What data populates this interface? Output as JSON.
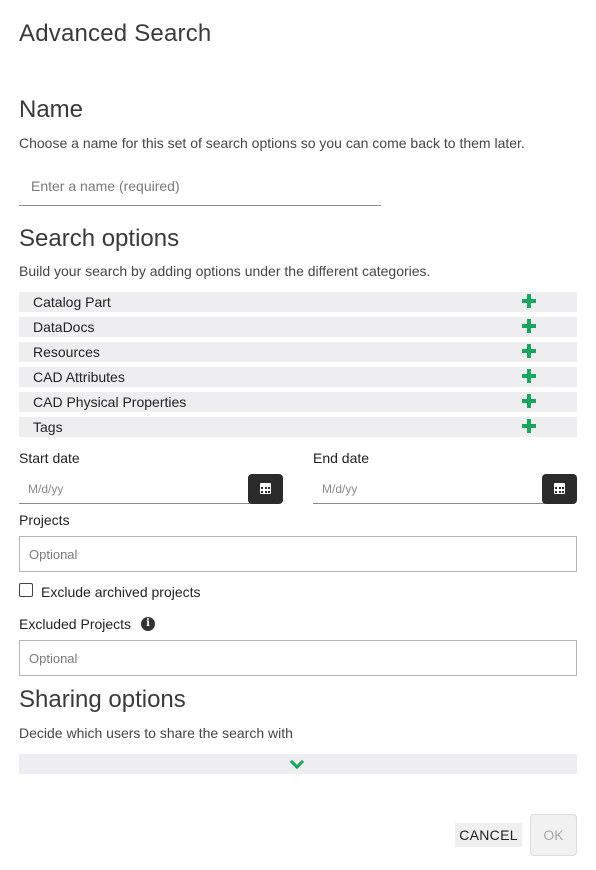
{
  "dialog": {
    "title": "Advanced Search"
  },
  "name_section": {
    "heading": "Name",
    "description": "Choose a name for this set of search options so you can come back to them later.",
    "input_placeholder": "Enter a name (required)",
    "input_value": ""
  },
  "search_section": {
    "heading": "Search options",
    "description": "Build your search by adding options under the different categories.",
    "categories": [
      {
        "label": "Catalog Part",
        "icon": "plus-icon"
      },
      {
        "label": "DataDocs",
        "icon": "plus-icon"
      },
      {
        "label": "Resources",
        "icon": "plus-icon"
      },
      {
        "label": "CAD Attributes",
        "icon": "plus-icon"
      },
      {
        "label": "CAD Physical Properties",
        "icon": "plus-icon"
      },
      {
        "label": "Tags",
        "icon": "plus-icon"
      }
    ],
    "start_date": {
      "label": "Start date",
      "placeholder": "M/d/yy",
      "value": ""
    },
    "end_date": {
      "label": "End date",
      "placeholder": "M/d/yy",
      "value": ""
    },
    "projects": {
      "label": "Projects",
      "placeholder": "Optional",
      "value": ""
    },
    "exclude_archived": {
      "label": "Exclude archived projects",
      "checked": false
    },
    "excluded_projects": {
      "label": "Excluded Projects",
      "placeholder": "Optional",
      "value": "",
      "info_icon": "info-icon"
    }
  },
  "sharing_section": {
    "heading": "Sharing options",
    "description": "Decide which users to share the search with",
    "expand_icon": "chevron-down-icon"
  },
  "actions": {
    "cancel_label": "CANCEL",
    "ok_label": "OK",
    "ok_enabled": false
  },
  "colors": {
    "accent": "#18a561",
    "row_background": "#eeeef0",
    "calendar_button": "#2b2b2b"
  }
}
